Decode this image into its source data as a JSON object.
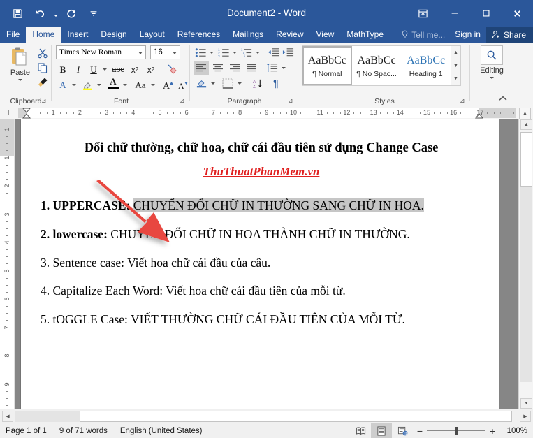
{
  "window": {
    "title": "Document2 - Word",
    "quick_access": [
      {
        "name": "save",
        "label": "Save"
      },
      {
        "name": "undo",
        "label": "Undo"
      },
      {
        "name": "redo",
        "label": "Redo"
      },
      {
        "name": "customize",
        "label": "Customize Quick Access Toolbar"
      }
    ],
    "controls": [
      {
        "name": "ribbon-display-options",
        "label": "Ribbon Display Options"
      },
      {
        "name": "minimize",
        "label": "Minimize"
      },
      {
        "name": "restore",
        "label": "Restore Down"
      },
      {
        "name": "close",
        "label": "Close"
      }
    ]
  },
  "ribbon": {
    "tabs": [
      {
        "label": "File",
        "active": false
      },
      {
        "label": "Home",
        "active": true
      },
      {
        "label": "Insert",
        "active": false
      },
      {
        "label": "Design",
        "active": false
      },
      {
        "label": "Layout",
        "active": false
      },
      {
        "label": "References",
        "active": false
      },
      {
        "label": "Mailings",
        "active": false
      },
      {
        "label": "Review",
        "active": false
      },
      {
        "label": "View",
        "active": false
      },
      {
        "label": "MathType",
        "active": false
      }
    ],
    "tell_me": "Tell me...",
    "sign_in": "Sign in",
    "share": "Share",
    "groups": {
      "clipboard": {
        "label": "Clipboard",
        "paste": "Paste",
        "cut": "Cut",
        "copy": "Copy",
        "format_painter": "Format Painter"
      },
      "font": {
        "label": "Font",
        "font_name": "Times New Roman",
        "font_size": "16",
        "bold": "B",
        "italic": "I",
        "underline": "U",
        "strikethrough": "abc",
        "subscript": "x",
        "superscript": "x",
        "clear_formatting": "Clear All Formatting",
        "text_effects": "A",
        "highlight": "Text Highlight Color",
        "font_color": "A",
        "change_case": "Aa",
        "grow_font": "A",
        "shrink_font": "A"
      },
      "paragraph": {
        "label": "Paragraph",
        "bullets": "Bullets",
        "numbering": "Numbering",
        "multilevel": "Multilevel List",
        "decrease_indent": "Decrease Indent",
        "increase_indent": "Increase Indent",
        "align_left": "Align Left",
        "align_center": "Center",
        "align_right": "Align Right",
        "justify": "Justify",
        "line_spacing": "Line and Paragraph Spacing",
        "shading": "Shading",
        "borders": "Borders",
        "sort": "Sort",
        "show_marks": "Show/Hide"
      },
      "styles": {
        "label": "Styles",
        "items": [
          {
            "preview": "AaBbCc",
            "name": "¶ Normal",
            "selected": true
          },
          {
            "preview": "AaBbCc",
            "name": "¶ No Spac...",
            "selected": false
          },
          {
            "preview": "AaBbCc",
            "name": "Heading 1",
            "selected": false
          }
        ]
      },
      "editing": {
        "label": "Editing",
        "button": "Editing"
      }
    }
  },
  "ruler": {
    "tab_stop": "L",
    "h_numbers": [
      "1",
      "2",
      "3",
      "4",
      "5",
      "6",
      "7",
      "8",
      "9",
      "10",
      "11",
      "12",
      "13",
      "14",
      "15",
      "16",
      "17"
    ],
    "v_numbers": [
      "1",
      "1",
      "2",
      "3",
      "4",
      "5",
      "6",
      "7",
      "8",
      "9"
    ]
  },
  "document": {
    "title": "Đổi chữ thường, chữ hoa, chữ cái đầu tiên sử dụng Change Case",
    "url": "ThuThuatPhanMem.vn",
    "items": [
      {
        "lead": "1. UPPERCASE:",
        "text": "CHUYỂN ĐỔI CHỮ IN THƯỜNG SANG CHỮ IN HOA.",
        "lead_bold": true,
        "highlighted": true
      },
      {
        "lead": "2. lowercase:",
        "text": "CHUYỂN ĐỔI CHỮ IN HOA THÀNH CHỮ IN THƯỜNG.",
        "lead_bold": true,
        "highlighted": false
      },
      {
        "lead": "3. Sentence case:",
        "text": "Viết hoa chữ cái đầu của câu.",
        "lead_bold": false,
        "highlighted": false
      },
      {
        "lead": "4. Capitalize Each Word:",
        "text": "Viết hoa chữ cái đầu tiên của mỗi từ.",
        "lead_bold": false,
        "highlighted": false
      },
      {
        "lead": "5. tOGGLE Case:",
        "text": "VIẾT THƯỜNG CHỮ CÁI ĐẦU TIÊN CỦA MỖI TỪ.",
        "lead_bold": false,
        "highlighted": false
      }
    ],
    "annotation": {
      "type": "arrow",
      "color": "#e8473f"
    }
  },
  "status_bar": {
    "page": "Page 1 of 1",
    "words": "9 of 71 words",
    "language": "English (United States)",
    "views": [
      {
        "name": "read-mode",
        "label": "Read Mode",
        "selected": false
      },
      {
        "name": "print-layout",
        "label": "Print Layout",
        "selected": true
      },
      {
        "name": "web-layout",
        "label": "Web Layout",
        "selected": false
      }
    ],
    "zoom_out": "−",
    "zoom_in": "+",
    "zoom": "100%"
  }
}
